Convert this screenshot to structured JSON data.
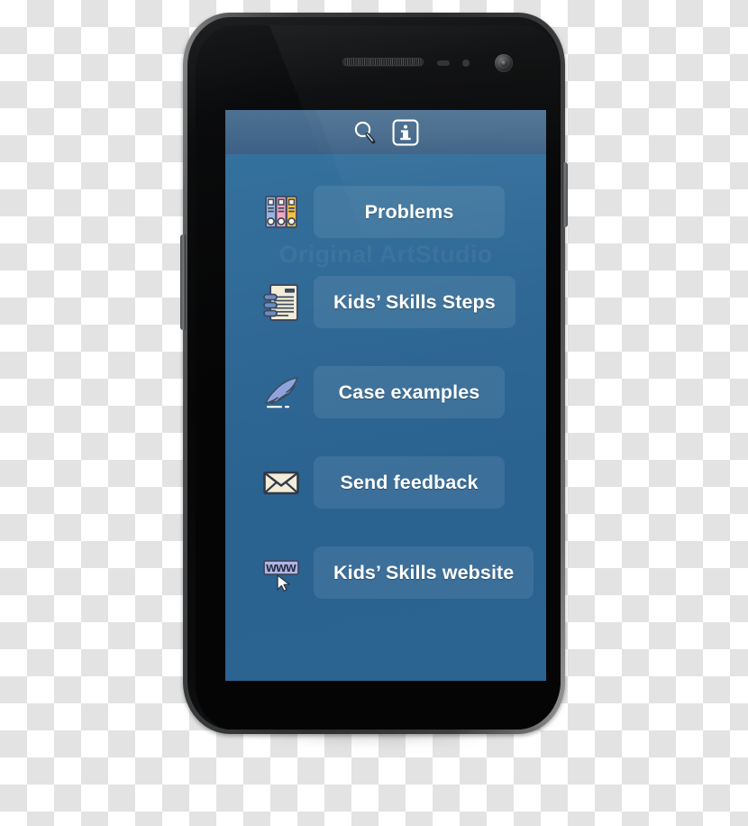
{
  "device": {
    "type": "smartphone",
    "hardware": {
      "earpiece": "earpiece-speaker",
      "proximity_sensor": "proximity-sensor",
      "light_sensor": "light-sensor",
      "front_camera": "front-camera",
      "power_button": "power-button",
      "volume_rocker": "volume-rocker"
    }
  },
  "app": {
    "background_color": "#2a6390",
    "topbar_color": "#44688b",
    "button_color": "rgba(255,255,255,0.085)",
    "text_color": "#ffffff",
    "watermark_text": "Original ArtStudio",
    "topbar": {
      "icons": [
        {
          "name": "search-icon",
          "label": "Search"
        },
        {
          "name": "info-icon",
          "label": "Info",
          "glyph": "i"
        }
      ]
    },
    "menu": {
      "items": [
        {
          "label": "Problems",
          "icon": "binders-icon"
        },
        {
          "label": "Kids’ Skills Steps",
          "icon": "notepad-icon"
        },
        {
          "label": "Case examples",
          "icon": "quill-pen-icon"
        },
        {
          "label": "Send feedback",
          "icon": "envelope-icon"
        },
        {
          "label": "Kids’ Skills website",
          "icon": "www-cursor-icon"
        }
      ]
    }
  }
}
